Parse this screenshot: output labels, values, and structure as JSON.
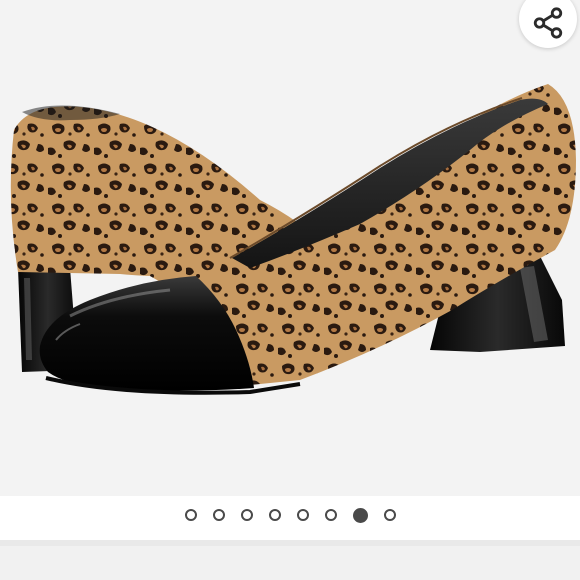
{
  "product": {
    "image_subject": "leopard-print-pump-with-black-patent-cap-toe"
  },
  "share": {
    "icon": "share-icon"
  },
  "carousel": {
    "total_slides": 8,
    "active_index": 6
  },
  "colors": {
    "background": "#f3f3f3",
    "dot": "#4a4a4a",
    "leopard_base": "#c99a62",
    "leopard_spot": "#2a1a10",
    "patent_black": "#0c0c0c"
  }
}
